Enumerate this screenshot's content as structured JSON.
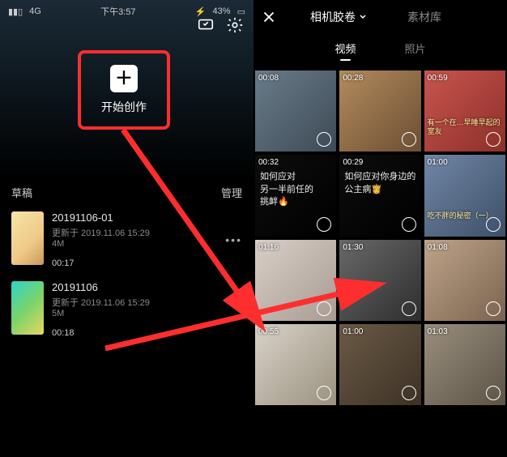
{
  "status": {
    "time": "下午3:57",
    "battery": "43%"
  },
  "hero": {
    "create_label": "开始创作"
  },
  "section": {
    "drafts": "草稿",
    "manage": "管理"
  },
  "projects": [
    {
      "title": "20191106-01",
      "meta": "更新于 2019.11.06 15:29",
      "size": "4M",
      "duration": "00:17"
    },
    {
      "title": "20191106",
      "meta": "更新于 2019.11.06 15:29",
      "size": "5M",
      "duration": "00:18"
    }
  ],
  "right": {
    "tabs": {
      "album": "相机胶卷",
      "library": "素材库"
    },
    "subtabs": {
      "video": "视频",
      "photo": "照片"
    },
    "cells": [
      {
        "type": "thumb",
        "dur": "00:08"
      },
      {
        "type": "thumb",
        "dur": "00:28"
      },
      {
        "type": "thumb",
        "dur": "00:59",
        "caption": "有一个在…早睡早起的室友"
      },
      {
        "type": "text",
        "dur": "00:32",
        "line1": "如何应对",
        "line2": "另一半前任的",
        "line3": "挑衅🔥"
      },
      {
        "type": "text",
        "dur": "00:29",
        "line1": "如何应对你身边的",
        "line2": "公主病👸"
      },
      {
        "type": "thumb",
        "dur": "01:00",
        "caption": "吃不胖的秘密（一）"
      },
      {
        "type": "thumb",
        "dur": "01:16"
      },
      {
        "type": "thumb",
        "dur": "01:30"
      },
      {
        "type": "thumb",
        "dur": "01:08"
      },
      {
        "type": "thumb",
        "dur": "00:55"
      },
      {
        "type": "thumb",
        "dur": "01:00"
      },
      {
        "type": "thumb",
        "dur": "01:03"
      }
    ]
  }
}
